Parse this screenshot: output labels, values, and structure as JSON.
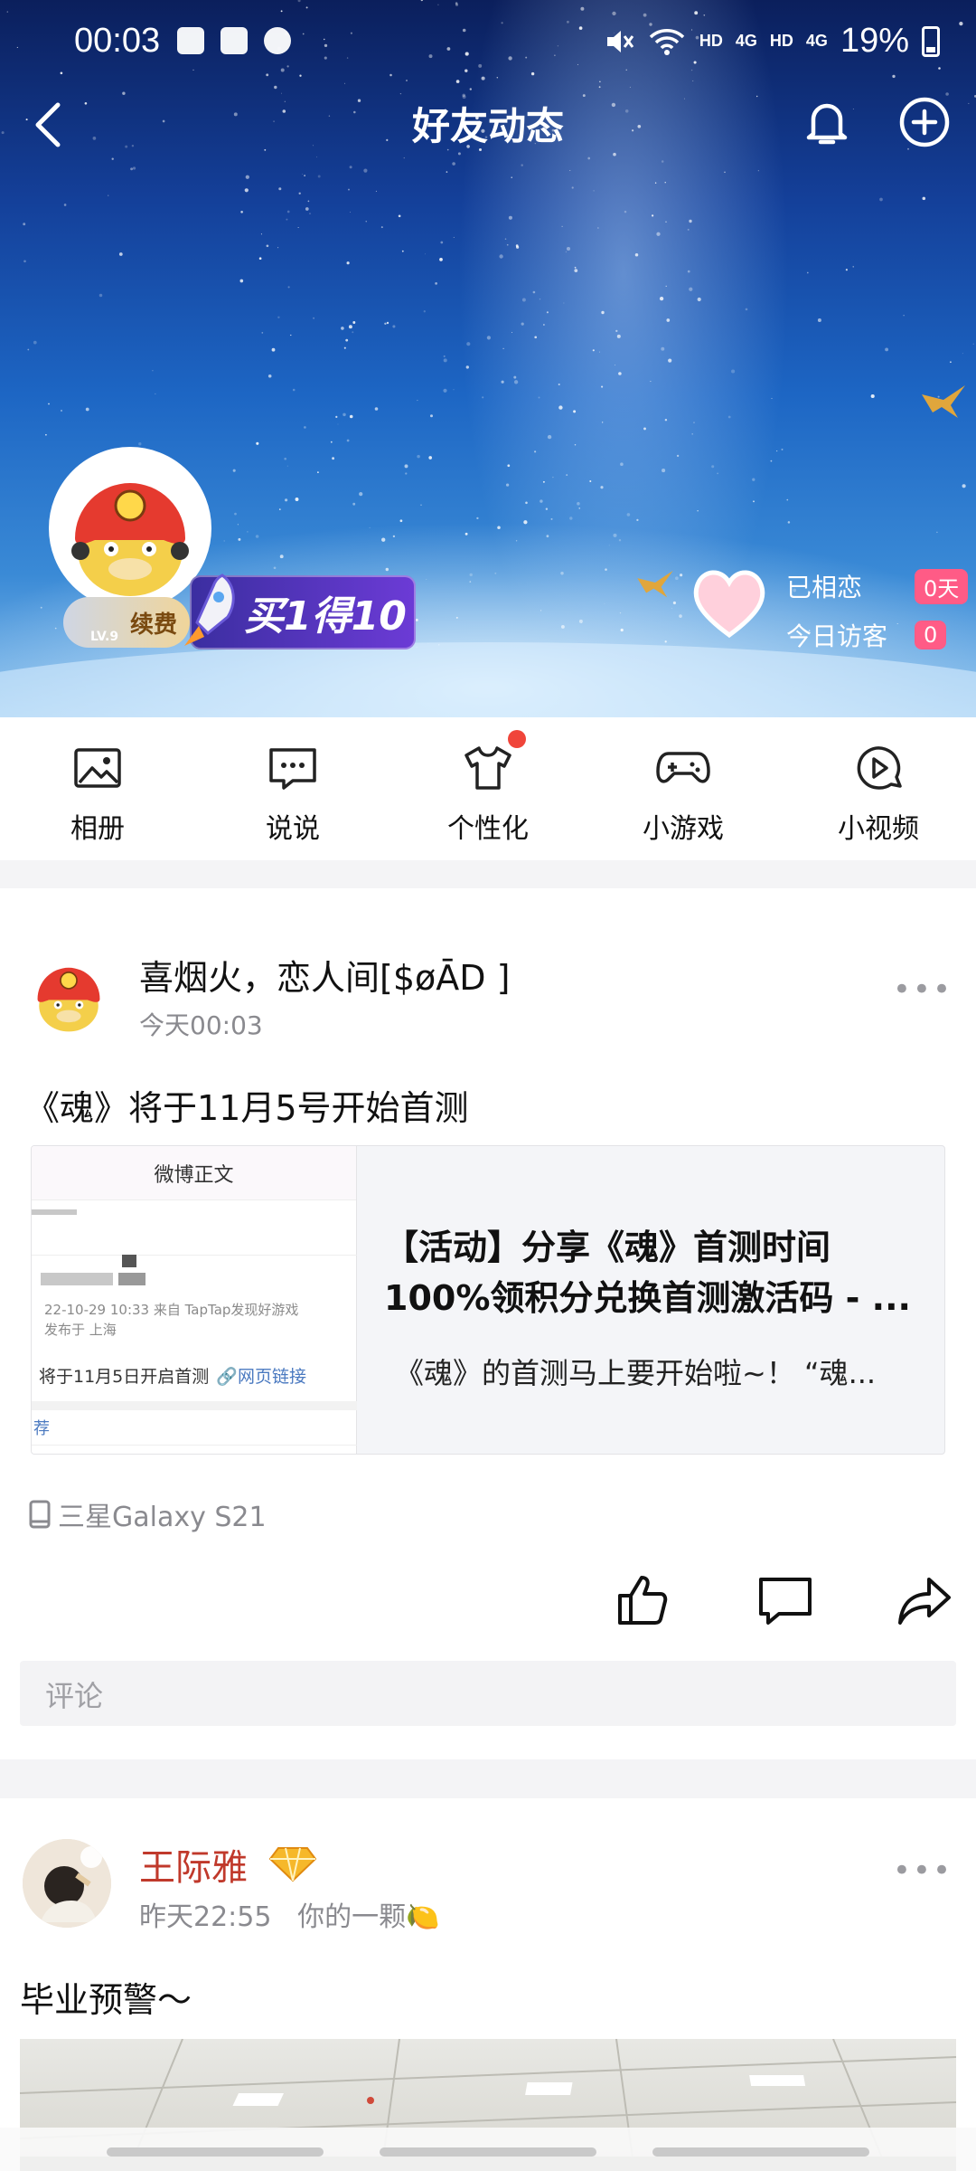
{
  "status_bar": {
    "time": "00:03",
    "battery": "19%",
    "net1": "HD",
    "net2": "4G",
    "net3": "HD",
    "net4": "4G"
  },
  "nav": {
    "title": "好友动态"
  },
  "profile": {
    "vip_text": "续费",
    "vip_level": "LV.9",
    "promo_text": "买1得10",
    "relation_label": "已相恋",
    "relation_days": "0天",
    "visitors_label": "今日访客",
    "visitors_count": "0"
  },
  "quick_nav": [
    {
      "label": "相册",
      "icon": "photo-album-icon"
    },
    {
      "label": "说说",
      "icon": "message-icon"
    },
    {
      "label": "个性化",
      "icon": "shirt-icon"
    },
    {
      "label": "小游戏",
      "icon": "gamepad-icon"
    },
    {
      "label": "小视频",
      "icon": "video-play-icon"
    }
  ],
  "post1": {
    "author": "喜烟火，恋人间[$øĀD ]",
    "time": "今天00:03",
    "text": "《魂》将于11月5号开始首测",
    "card": {
      "thumb_header": "微博正文",
      "thumb_meta_line1": "22-10-29 10:33  来自 TapTap发现好游戏",
      "thumb_meta_line2": "发布于 上海",
      "thumb_line": "将于11月5日开启首测",
      "thumb_link": "网页链接",
      "thumb_rec": "荐",
      "title": "【活动】分享《魂》首测时间\n100%领积分兑换首测激活码 - ...",
      "desc": "《魂》的首测马上要开始啦~！ “魂..."
    },
    "device": "三星Galaxy S21",
    "comment_placeholder": "评论"
  },
  "post2": {
    "author": "王际雅",
    "time": "昨天22:55",
    "extra": "你的一颗🍋",
    "text": "毕业预警～"
  },
  "colors": {
    "accent_red": "#f0453a",
    "pink": "#ff5b86",
    "name_red": "#c0392b"
  }
}
